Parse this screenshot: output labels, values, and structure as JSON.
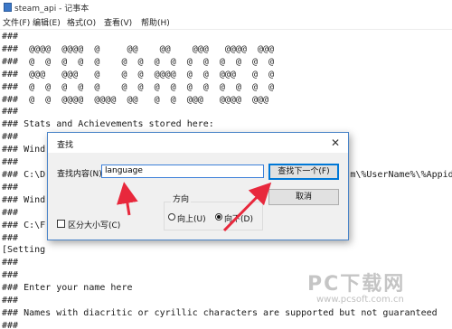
{
  "window": {
    "title": "steam_api - 记事本"
  },
  "menu": [
    "文件(F)",
    "编辑(E)",
    "格式(O)",
    "查看(V)",
    "帮助(H)"
  ],
  "editor_text": "###\n###  @@@@  @@@@  @     @@    @@    @@@   @@@@  @@@\n###  @  @  @  @  @    @  @  @  @  @  @  @  @  @  @\n###  @@@   @@@   @    @  @  @@@@  @  @  @@@   @  @\n###  @  @  @  @  @    @  @  @  @  @  @  @  @  @  @\n###  @  @  @@@@  @@@@  @@   @  @  @@@   @@@@  @@@\n###\n### Stats and Achievements stored here:\n###\n### Wind\n###\n### C:\\D                                                        m\\%UserName%\\%Appid\n###\n### Wind\n###\n### C:\\F\n###\n[Setting\n###\n###\n### Enter your name here\n###\n### Names with diacritic or cyrillic characters are supported but not guaranteed\n###\nUserName = RLD!",
  "find_dialog": {
    "title": "查找",
    "find_label": "查找内容(N):",
    "search_value": "language",
    "find_next_label": "查找下一个(F)",
    "cancel_label": "取消",
    "direction_label": "方向",
    "up_label": "向上(U)",
    "down_label": "向下(D)",
    "match_case_label": "区分大小写(C)",
    "direction_selected": "down",
    "match_case_checked": false
  },
  "watermark": {
    "brand": "PC下载网",
    "url": "www.pcsoft.com.cn"
  },
  "colors": {
    "dialog_border": "#4a84c8",
    "input_focus": "#3c7fd8",
    "arrow": "#e8283c"
  }
}
